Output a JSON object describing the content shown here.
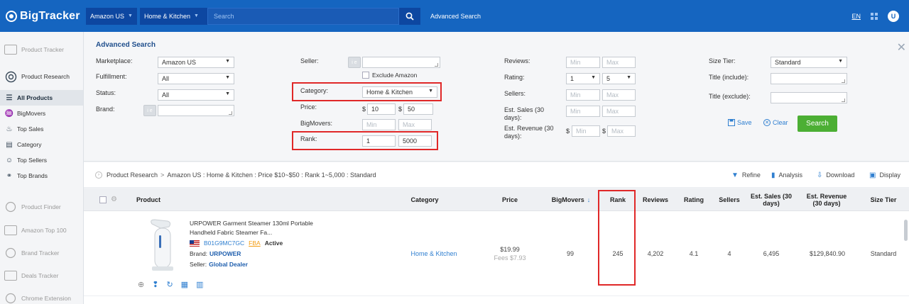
{
  "app": {
    "name": "BigTracker",
    "marketplace": "Amazon US",
    "category": "Home & Kitchen",
    "search_placeholder": "Search",
    "advanced_search": "Advanced Search",
    "lang": "EN",
    "user_initial": "U"
  },
  "sidebar": {
    "items": [
      {
        "label": "Product Tracker",
        "icon": "product-tracker-icon"
      },
      {
        "label": "Product Research",
        "icon": "product-research-icon"
      },
      {
        "label": "All Products",
        "icon": "list-icon"
      },
      {
        "label": "BigMovers",
        "icon": "bigmovers-icon"
      },
      {
        "label": "Top Sales",
        "icon": "top-sales-icon"
      },
      {
        "label": "Category",
        "icon": "category-icon"
      },
      {
        "label": "Top Sellers",
        "icon": "top-sellers-icon"
      },
      {
        "label": "Top Brands",
        "icon": "top-brands-icon"
      },
      {
        "label": "Product Finder",
        "icon": "product-finder-icon"
      },
      {
        "label": "Amazon Top 100",
        "icon": "top100-icon"
      },
      {
        "label": "Brand Tracker",
        "icon": "brand-tracker-icon"
      },
      {
        "label": "Deals Tracker",
        "icon": "deals-tracker-icon"
      },
      {
        "label": "Chrome Extension",
        "icon": "chrome-extension-icon"
      }
    ]
  },
  "adv": {
    "title": "Advanced Search",
    "marketplace_label": "Marketplace:",
    "marketplace_value": "Amazon US",
    "fulfillment_label": "Fulfillment:",
    "fulfillment_value": "All",
    "status_label": "Status:",
    "status_value": "All",
    "brand_label": "Brand:",
    "seller_label": "Seller:",
    "exclude_amazon": "Exclude Amazon",
    "category_label": "Category:",
    "category_value": "Home & Kitchen",
    "price_label": "Price:",
    "price_min": "10",
    "price_max": "50",
    "bigmovers_label": "BigMovers:",
    "rank_label": "Rank:",
    "rank_min": "1",
    "rank_max": "5000",
    "reviews_label": "Reviews:",
    "rating_label": "Rating:",
    "rating_min": "1",
    "rating_max": "5",
    "sellers_label": "Sellers:",
    "est_sales_label": "Est. Sales (30 days):",
    "est_revenue_label": "Est. Revenue (30 days):",
    "min_ph": "Min",
    "max_ph": "Max",
    "currency": "$",
    "size_tier_label": "Size Tier:",
    "size_tier_value": "Standard",
    "title_include_label": "Title (include):",
    "title_exclude_label": "Title (exclude):",
    "save": "Save",
    "clear": "Clear",
    "search": "Search"
  },
  "crumb": {
    "root": "Product Research",
    "path": "Amazon US : Home & Kitchen : Price $10~$50 : Rank 1~5,000 : Standard",
    "refine": "Refine",
    "analysis": "Analysis",
    "download": "Download",
    "display": "Display"
  },
  "table": {
    "headers": {
      "product": "Product",
      "category": "Category",
      "price": "Price",
      "bigmovers": "BigMovers",
      "rank": "Rank",
      "reviews": "Reviews",
      "rating": "Rating",
      "sellers": "Sellers",
      "est_sales": "Est. Sales (30 days)",
      "est_revenue": "Est. Revenue (30 days)",
      "size_tier": "Size Tier"
    },
    "rows": [
      {
        "title": "URPOWER Garment Steamer 130ml Portable Handheld Fabric Steamer Fa...",
        "asin": "B01G9MC7GC",
        "fba": "FBA",
        "status": "Active",
        "brand_label": "Brand:",
        "brand": "URPOWER",
        "seller_label": "Seller:",
        "seller": "Global Dealer",
        "category": "Home & Kitchen",
        "price": "$19.99",
        "fees": "Fees $7.93",
        "bigmovers": "99",
        "rank": "245",
        "reviews": "4,202",
        "rating": "4.1",
        "sellers": "4",
        "est_sales": "6,495",
        "est_revenue": "$129,840.90",
        "size_tier": "Standard"
      }
    ]
  },
  "colors": {
    "topbar": "#1565c0",
    "highlight": "#e02828",
    "accent_blue": "#2f7fd0",
    "search_green": "#4caf34"
  }
}
